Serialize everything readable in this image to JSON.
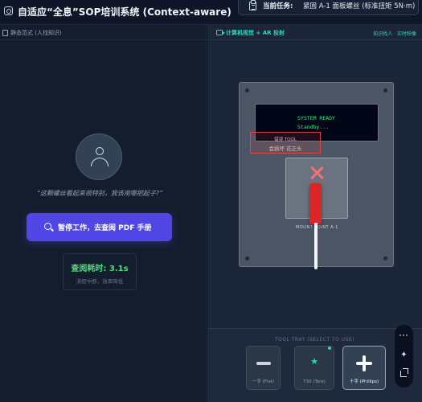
{
  "header": {
    "title": "自适应“全息”SOP培训系统 (Context-aware)",
    "task_label": "当前任务:",
    "task_value": "紧固 A-1 面板螺丝 (标准扭矩 5N·m)"
  },
  "left_panel": {
    "heading": "静态范式 (人找知识)",
    "quote": "“这颗螺丝看起来很特别，我该用哪把起子?”",
    "pdf_button_label": "暂停工作，去查阅 PDF 手册",
    "stat_title": "查阅耗时: 3.1s",
    "stat_subtitle": "流程中断，效率降低"
  },
  "right_panel": {
    "heading": "计算机视觉 + AR 投射",
    "heading_meta": "知识找人 · 实时映像",
    "display_line1": "SYSTEM READY",
    "display_line2": "Standby...",
    "ar_line1": "错误 TOOL",
    "ar_line2": "会损坏 花正头",
    "mount_label": "MOUNT POINT A-1",
    "tray_title": "TOOL TRAY (SELECT TO USE)",
    "tools": [
      {
        "label": "一字 (Flat)",
        "icon": "flat-screwdriver-icon",
        "selected": false
      },
      {
        "label": "T30 (Torx)",
        "icon": "torx-star-icon",
        "selected": false
      },
      {
        "label": "十字 (Phillips)",
        "icon": "phillips-plus-icon",
        "selected": true
      }
    ]
  },
  "icons": {
    "torx_glyph": "★"
  },
  "colors": {
    "accent_primary": "#4f46e5",
    "accent_teal": "#2dd4bf",
    "success_green": "#4ade80",
    "warning_red": "#ef4444",
    "background": "#0c1424"
  }
}
